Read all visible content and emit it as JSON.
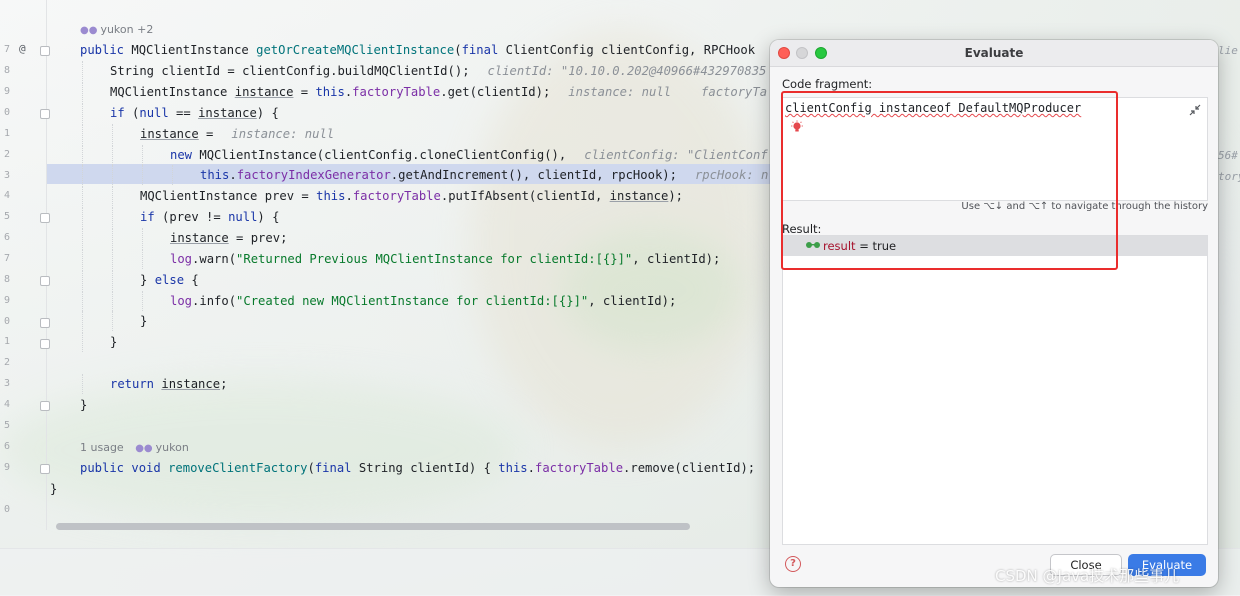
{
  "editor": {
    "line_numbers": [
      "7",
      "8",
      "9",
      "0",
      "1",
      "2",
      "3",
      "4",
      "5",
      "6",
      "7",
      "8",
      "9",
      "0",
      "1",
      "2",
      "3",
      "4",
      "5",
      "6",
      "9",
      "0"
    ],
    "lens_top": "yukon +2",
    "lens_bottom_usage": "1 usage",
    "lens_bottom_author": "yukon",
    "lines": {
      "l1": {
        "p1": "public ",
        "p2": "MQClientInstance ",
        "p3": "getOrCreateMQClientInstance",
        "p4": "(",
        "p5": "final ",
        "p6": "ClientConfig clientConfig, RPCHook"
      },
      "l2": {
        "p1": "String clientId = clientConfig.buildMQClientId();",
        "hint": "clientId: \"10.10.0.202@40966#432970835"
      },
      "l3": {
        "p1": "MQClientInstance ",
        "p2": "instance",
        "p3": " = ",
        "p4": "this",
        "p5": ".",
        "p6": "factoryTable",
        "p7": ".get(clientId);",
        "hint1": "instance: null",
        "hint2": "factoryTa"
      },
      "l4": {
        "p1": "if ",
        "p2": "(",
        "p3": "null",
        "p4": " == ",
        "p5": "instance",
        "p6": ") {"
      },
      "l5": {
        "p1": "instance",
        "p2": " =",
        "hint": "instance: null"
      },
      "l6": {
        "p1": "new ",
        "p2": "MQClientInstance(clientConfig.cloneClientConfig(),",
        "hint": "clientConfig: \"ClientConf"
      },
      "l7": {
        "p1": "this",
        "p2": ".",
        "p3": "factoryIndexGenerator",
        "p4": ".getAndIncrement(), clientId, rpcHook);",
        "hint": "rpcHook: n"
      },
      "l8": {
        "p1": "MQClientInstance prev = ",
        "p2": "this",
        "p3": ".",
        "p4": "factoryTable",
        "p5": ".putIfAbsent(clientId, ",
        "p6": "instance",
        "p7": ");"
      },
      "l9": {
        "p1": "if ",
        "p2": "(prev != ",
        "p3": "null",
        "p4": ") {"
      },
      "l10": {
        "p1": "instance",
        "p2": " = prev;"
      },
      "l11": {
        "p1": "log",
        "p2": ".warn(",
        "p3": "\"Returned Previous MQClientInstance for clientId:[{}]\"",
        "p4": ", clientId);"
      },
      "l12": {
        "p1": "} ",
        "p2": "else",
        "p3": " {"
      },
      "l13": {
        "p1": "log",
        "p2": ".info(",
        "p3": "\"Created new MQClientInstance for clientId:[{}]\"",
        "p4": ", clientId);"
      },
      "l14": {
        "p1": "}"
      },
      "l15": {
        "p1": "}"
      },
      "l16": {
        "p1": "return ",
        "p2": "instance",
        "p3": ";"
      },
      "l17": {
        "p1": "}"
      },
      "l18": {
        "p1": "public void ",
        "p2": "removeClientFactory",
        "p3": "(",
        "p4": "final ",
        "p5": "String clientId) { ",
        "p6": "this",
        "p7": ".",
        "p8": "factoryTable",
        "p9": ".remove(clientId);"
      },
      "l19": {
        "p1": "}"
      }
    },
    "edge_text": [
      "lie",
      "56#",
      "tory"
    ]
  },
  "dialog": {
    "title": "Evaluate",
    "code_fragment_label": "Code fragment:",
    "code_fragment_value": "clientConfig instanceof DefaultMQProducer",
    "history_hint": "Use ⌥↓ and ⌥↑ to navigate through the history",
    "result_label": "Result:",
    "result_var": "result",
    "result_eq": " = true",
    "close_label": "Close",
    "evaluate_label": "Evaluate"
  },
  "watermark": "CSDN @Java技术那些事儿",
  "colors": {
    "keyword": "#1a36a8",
    "method": "#00737a",
    "field": "#7b2ea6",
    "string": "#087a2c",
    "annotation_red": "#ea2d2d",
    "primary_button": "#3a7be6"
  }
}
